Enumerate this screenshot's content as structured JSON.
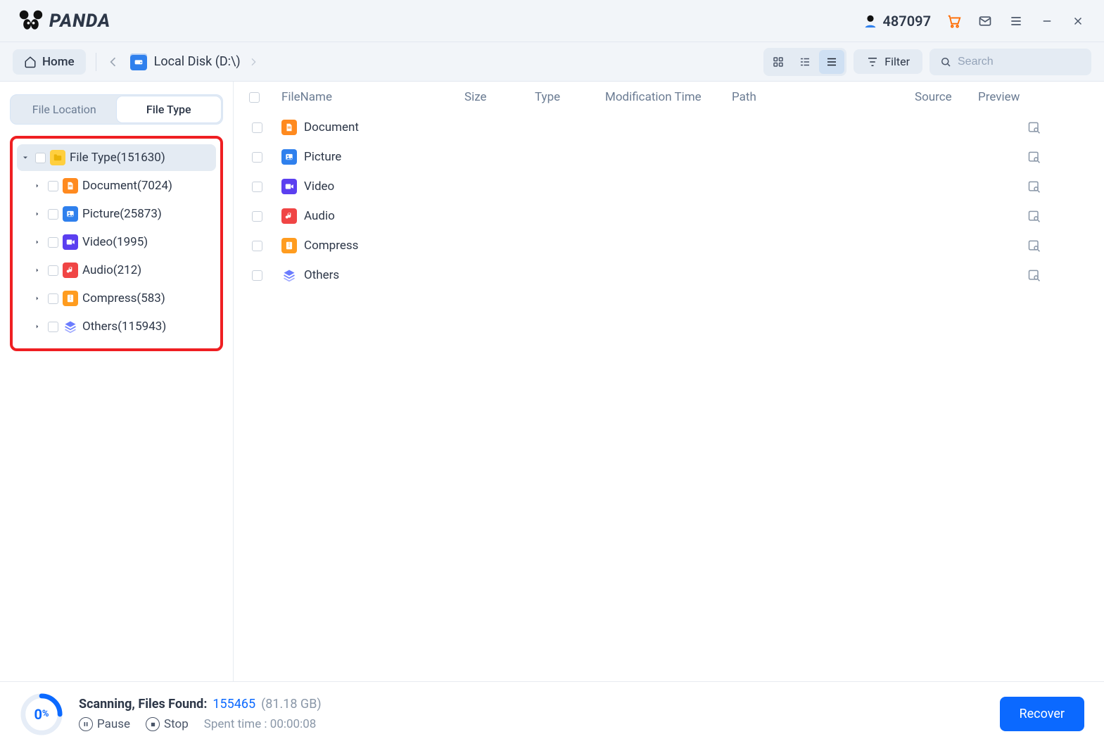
{
  "app": {
    "name": "PANDA"
  },
  "titlebar": {
    "user_count": "487097"
  },
  "toolbar": {
    "home": "Home",
    "location": "Local Disk (D:\\)",
    "filter_label": "Filter",
    "search_placeholder": "Search"
  },
  "sidebar": {
    "tabs": {
      "location": "File Location",
      "type": "File Type"
    },
    "root": {
      "label": "File Type",
      "count": "(151630)"
    },
    "items": [
      {
        "label": "Document",
        "count": "(7024)",
        "icon": "doc"
      },
      {
        "label": "Picture",
        "count": "(25873)",
        "icon": "pic"
      },
      {
        "label": "Video",
        "count": "(1995)",
        "icon": "vid"
      },
      {
        "label": "Audio",
        "count": "(212)",
        "icon": "aud"
      },
      {
        "label": "Compress",
        "count": "(583)",
        "icon": "comp"
      },
      {
        "label": "Others",
        "count": "(115943)",
        "icon": "oth"
      }
    ]
  },
  "columns": {
    "name": "FileName",
    "size": "Size",
    "type": "Type",
    "mtime": "Modification Time",
    "path": "Path",
    "source": "Source",
    "preview": "Preview"
  },
  "rows": [
    {
      "name": "Document",
      "icon": "doc"
    },
    {
      "name": "Picture",
      "icon": "pic"
    },
    {
      "name": "Video",
      "icon": "vid"
    },
    {
      "name": "Audio",
      "icon": "aud"
    },
    {
      "name": "Compress",
      "icon": "comp"
    },
    {
      "name": "Others",
      "icon": "oth"
    }
  ],
  "status": {
    "percent": "0",
    "label": "Scanning, Files Found:",
    "count": "155465",
    "size": "(81.18 GB)",
    "pause": "Pause",
    "stop": "Stop",
    "spent_label": "Spent time :",
    "spent_value": "00:00:08",
    "recover": "Recover"
  },
  "colors": {
    "accent": "#0b69ff",
    "highlight": "#ef1f22"
  }
}
